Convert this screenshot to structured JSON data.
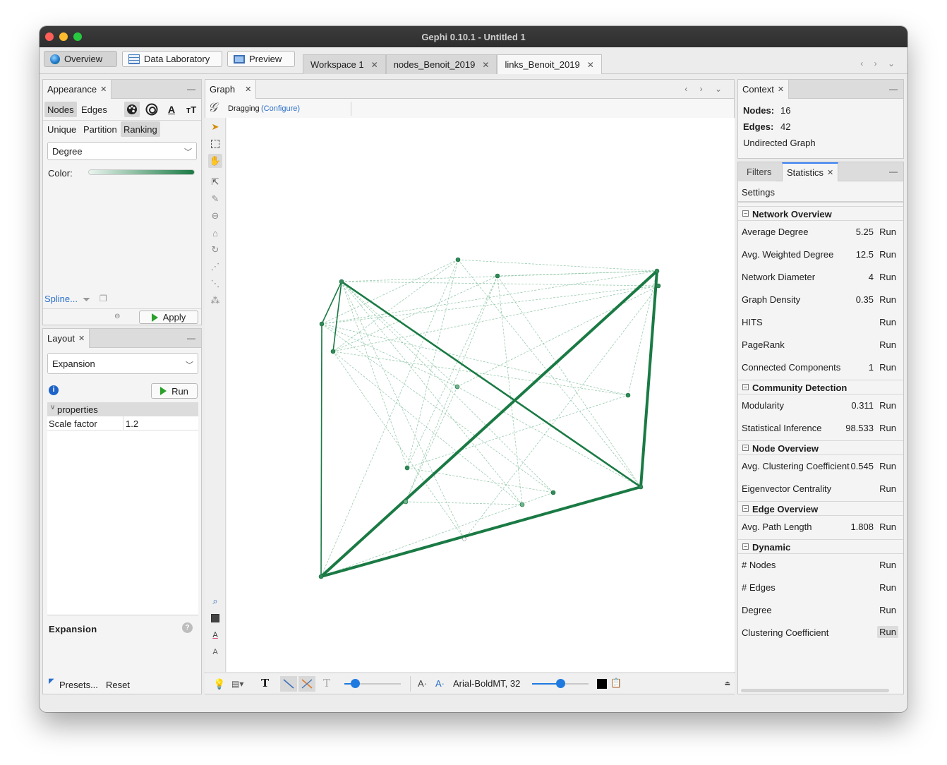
{
  "window": {
    "title": "Gephi 0.10.1 - Untitled 1"
  },
  "modes": [
    {
      "label": "Overview",
      "active": true
    },
    {
      "label": "Data Laboratory",
      "active": false
    },
    {
      "label": "Preview",
      "active": false
    }
  ],
  "doc_tabs": [
    {
      "label": "Workspace 1",
      "active": false
    },
    {
      "label": "nodes_Benoit_2019",
      "active": false
    },
    {
      "label": "links_Benoit_2019",
      "active": true
    }
  ],
  "appearance": {
    "tab": "Appearance",
    "element_tabs": [
      "Nodes",
      "Edges"
    ],
    "mode_tabs": [
      "Unique",
      "Partition",
      "Ranking"
    ],
    "attribute": "Degree",
    "color_label": "Color:",
    "gradient_colors": [
      "#eaf5ef",
      "#1a7a44"
    ],
    "spline_label": "Spline...",
    "apply_label": "Apply"
  },
  "layout": {
    "tab": "Layout",
    "algorithm": "Expansion",
    "run_label": "Run",
    "properties_header": "properties",
    "properties": [
      {
        "name": "Scale factor",
        "value": "1.2"
      }
    ],
    "description_title": "Expansion",
    "presets_label": "Presets...",
    "reset_label": "Reset"
  },
  "graph": {
    "tab": "Graph",
    "tool_label": "Dragging",
    "configure_label": "(Configure)",
    "font_label": "Arial-BoldMT, 32",
    "edge_color": "#1a7a44"
  },
  "context": {
    "tab": "Context",
    "nodes_label": "Nodes:",
    "nodes_value": "16",
    "edges_label": "Edges:",
    "edges_value": "42",
    "graph_type": "Undirected Graph"
  },
  "statistics": {
    "tabs": [
      "Filters",
      "Statistics"
    ],
    "settings_label": "Settings",
    "run_label": "Run",
    "sections": [
      {
        "title": "Network Overview",
        "rows": [
          {
            "label": "Average Degree",
            "value": "5.25"
          },
          {
            "label": "Avg. Weighted Degree",
            "value": "12.5"
          },
          {
            "label": "Network Diameter",
            "value": "4"
          },
          {
            "label": "Graph Density",
            "value": "0.35"
          },
          {
            "label": "HITS",
            "value": ""
          },
          {
            "label": "PageRank",
            "value": ""
          },
          {
            "label": "Connected Components",
            "value": "1"
          }
        ]
      },
      {
        "title": "Community Detection",
        "rows": [
          {
            "label": "Modularity",
            "value": "0.311"
          },
          {
            "label": "Statistical Inference",
            "value": "98.533"
          }
        ]
      },
      {
        "title": "Node Overview",
        "rows": [
          {
            "label": "Avg. Clustering Coefficient",
            "value": "0.545"
          },
          {
            "label": "Eigenvector Centrality",
            "value": ""
          }
        ]
      },
      {
        "title": "Edge Overview",
        "rows": [
          {
            "label": "Avg. Path Length",
            "value": "1.808"
          }
        ]
      },
      {
        "title": "Dynamic",
        "rows": [
          {
            "label": "# Nodes",
            "value": ""
          },
          {
            "label": "# Edges",
            "value": ""
          },
          {
            "label": "Degree",
            "value": ""
          },
          {
            "label": "Clustering Coefficient",
            "value": ""
          }
        ]
      }
    ]
  }
}
